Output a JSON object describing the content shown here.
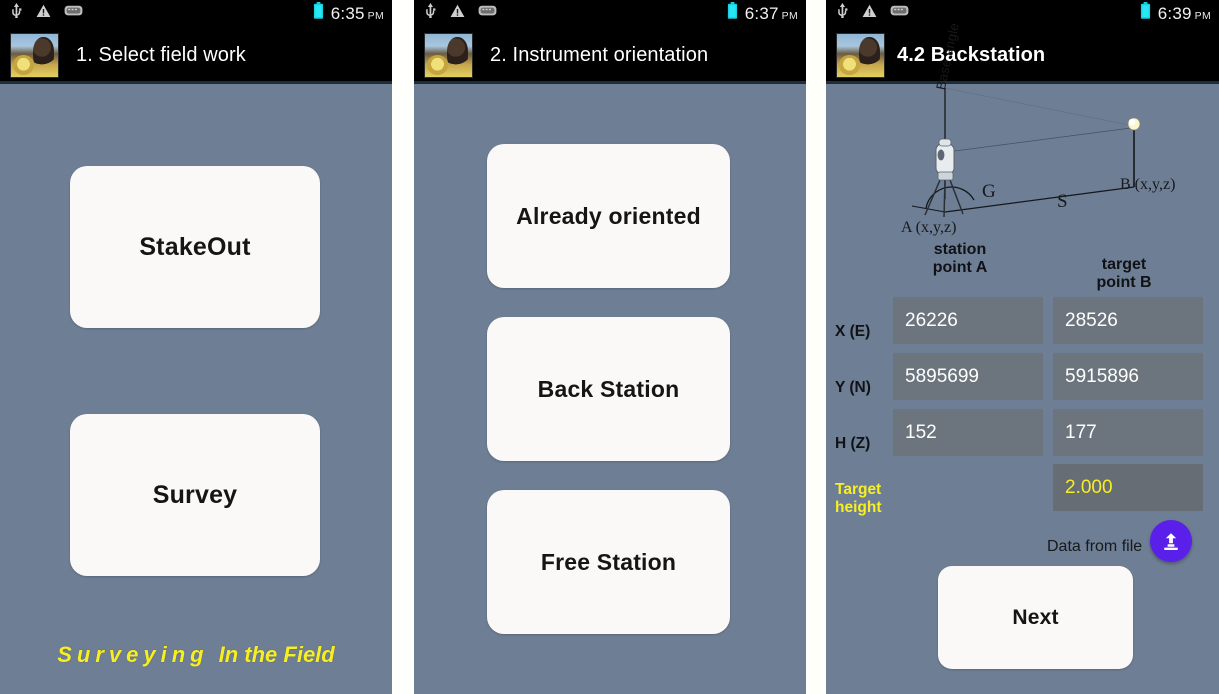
{
  "screens": [
    {
      "id": "select-field-work",
      "statusbar": {
        "icons": [
          "usb-icon",
          "warning-icon",
          "sdcard-icon",
          "battery-icon"
        ],
        "time": "6:35",
        "ampm": "PM"
      },
      "title": "1. Select field work",
      "buttons": [
        {
          "label": "StakeOut"
        },
        {
          "label": "Survey"
        }
      ],
      "footer": {
        "word1": "Surveying",
        "word2": "In the Field",
        "color": "#f7ef23"
      }
    },
    {
      "id": "instrument-orientation",
      "statusbar": {
        "icons": [
          "usb-icon",
          "warning-icon",
          "sdcard-icon",
          "battery-icon"
        ],
        "time": "6:37",
        "ampm": "PM"
      },
      "title": "2. Instrument orientation",
      "back_button": "back-arrow",
      "buttons": [
        {
          "label": "Already oriented"
        },
        {
          "label": "Back Station"
        },
        {
          "label": "Free Station"
        }
      ]
    },
    {
      "id": "backstation",
      "statusbar": {
        "icons": [
          "usb-icon",
          "warning-icon",
          "sdcard-icon",
          "battery-icon"
        ],
        "time": "6:39",
        "ampm": "PM"
      },
      "title": "4.2 Backstation",
      "back_button": "back-arrow",
      "diagram": {
        "base_angle": "Base angle",
        "angle_g": "G",
        "distance_s": "S",
        "point_a": "A (x,y,z)",
        "point_b": "B (x,y,z)"
      },
      "columns": [
        {
          "line1": "station",
          "line2": "point A"
        },
        {
          "line1": "target",
          "line2": "point B"
        }
      ],
      "rows": [
        {
          "label": "X (E)",
          "a": "26226",
          "b": "28526"
        },
        {
          "label": "Y (N)",
          "a": "5895699",
          "b": "5915896"
        },
        {
          "label": "H (Z)",
          "a": "152",
          "b": "177"
        }
      ],
      "target_height": {
        "label1": "Target",
        "label2": "height",
        "value": "2.000"
      },
      "data_from_file": {
        "label": "Data from file",
        "icon": "file-import-icon",
        "color": "#5a1fe8"
      },
      "next_button": "Next"
    }
  ],
  "theme": {
    "background": "#6e7e95",
    "button_face": "#fbf8f8",
    "field_bg": "#6c747d",
    "accent_yellow": "#f7ef23",
    "statusbar_bg": "#000000"
  }
}
